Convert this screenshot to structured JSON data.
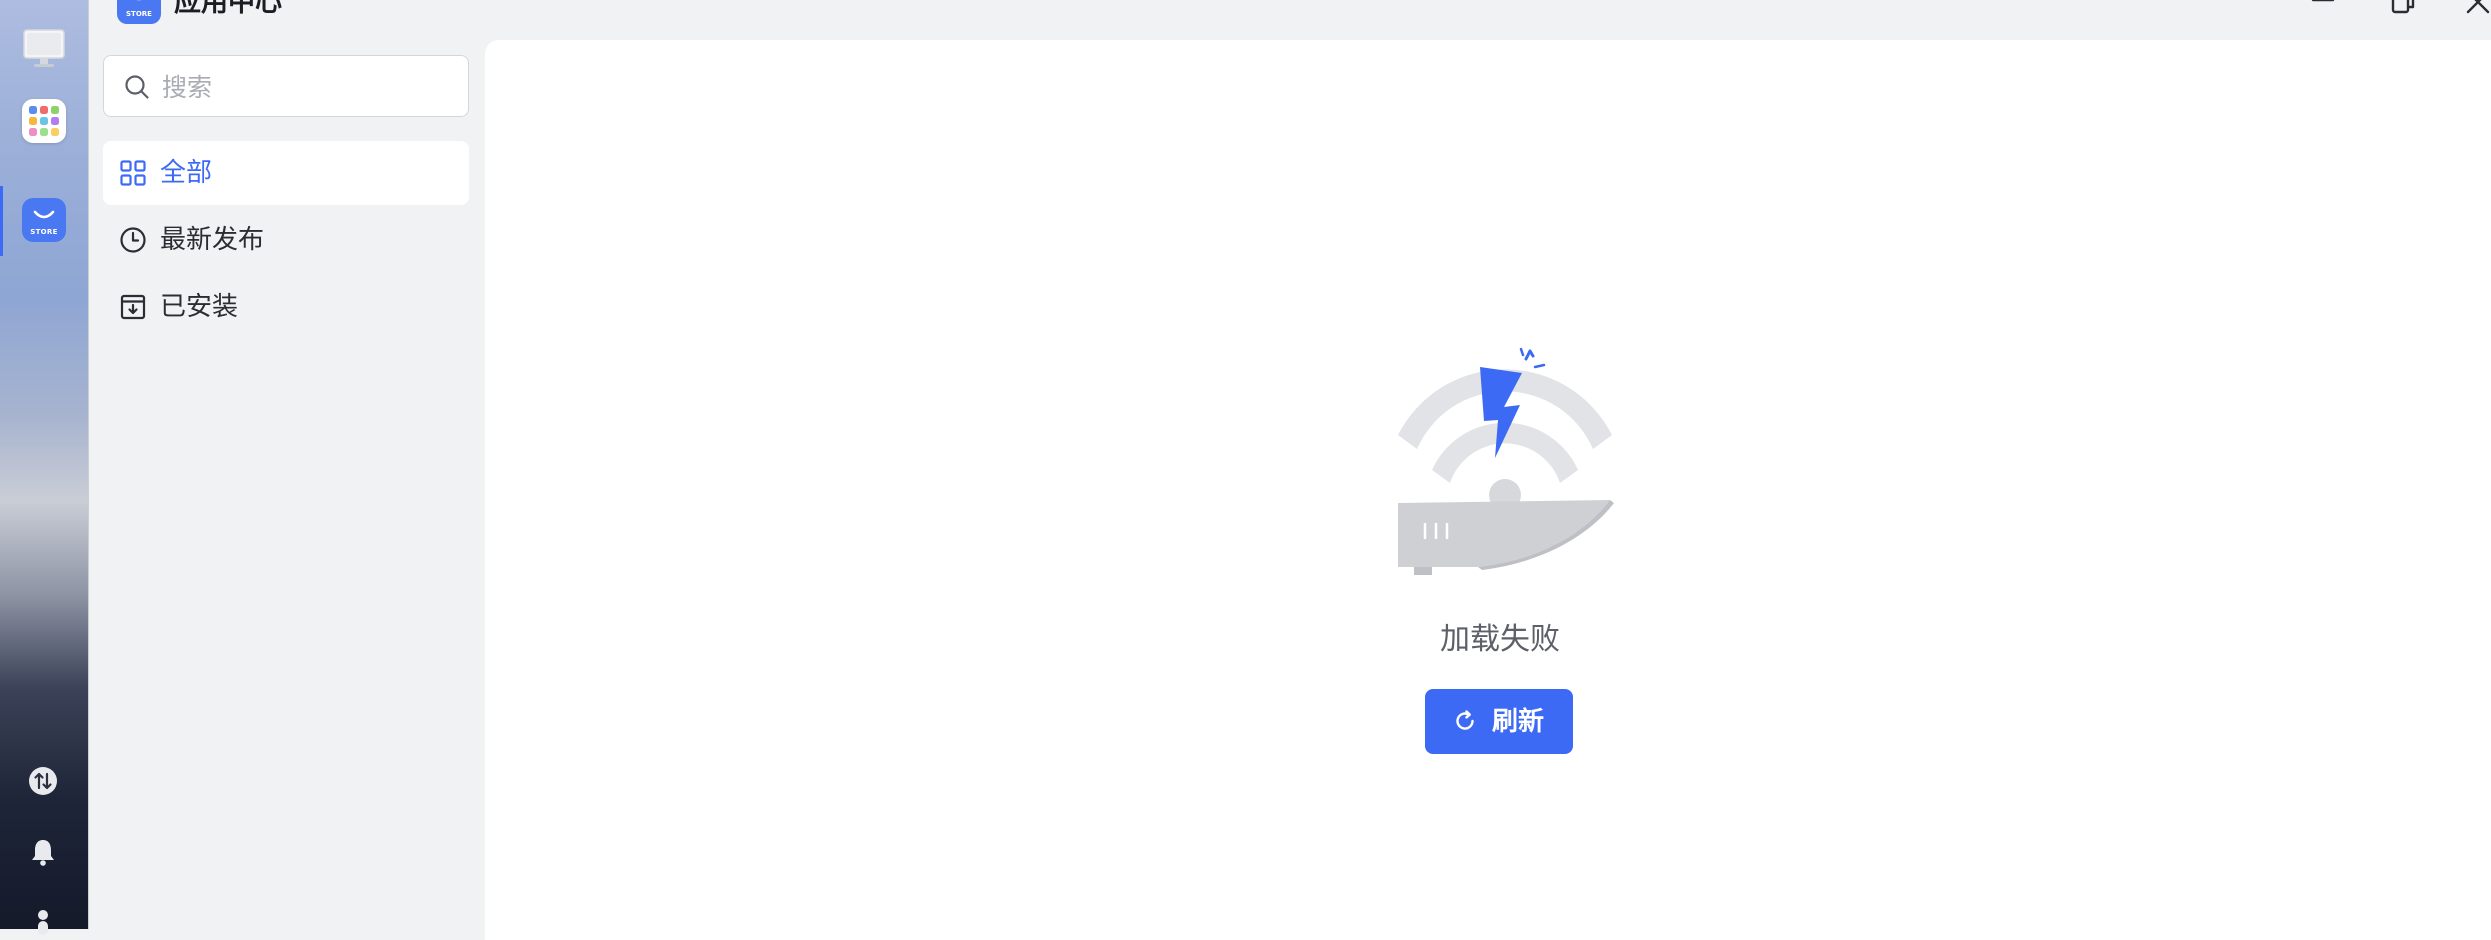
{
  "window": {
    "title": "应用中心",
    "logo_text": "STORE"
  },
  "dock": {
    "items": [
      {
        "name": "desktop",
        "icon": "monitor-icon"
      },
      {
        "name": "launcher",
        "icon": "app-grid-icon"
      },
      {
        "name": "app-store",
        "icon": "store-icon",
        "label": "STORE",
        "active": true
      }
    ],
    "tools": [
      "network-transfer-icon",
      "bell-icon",
      "power-icon"
    ]
  },
  "search": {
    "placeholder": "搜索",
    "value": ""
  },
  "sidebar": {
    "items": [
      {
        "label": "全部",
        "icon": "grid-icon",
        "active": true
      },
      {
        "label": "最新发布",
        "icon": "clock-icon",
        "active": false
      },
      {
        "label": "已安装",
        "icon": "download-box-icon",
        "active": false
      }
    ]
  },
  "main": {
    "error_message": "加载失败",
    "refresh_label": "刷新",
    "illustration": "network-error-illustration"
  },
  "colors": {
    "accent": "#3d6af5",
    "panel_bg": "#f1f2f4",
    "content_bg": "#ffffff",
    "illustration_gray": "#e2e3e6"
  }
}
